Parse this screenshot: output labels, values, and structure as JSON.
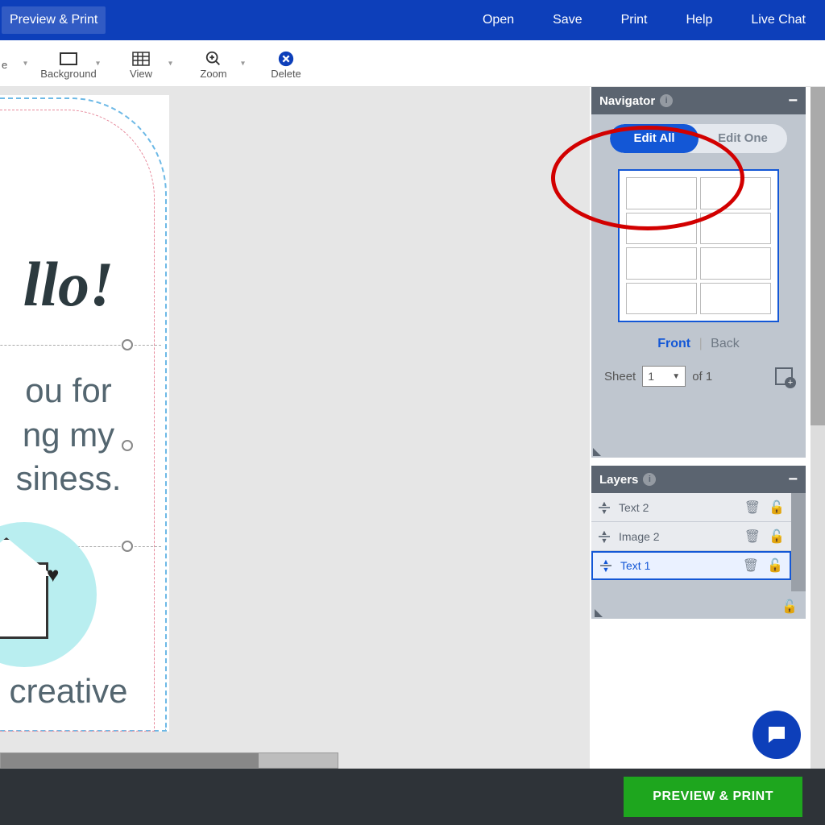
{
  "menu": {
    "preview": "Preview & Print",
    "open": "Open",
    "save": "Save",
    "print": "Print",
    "help": "Help",
    "chat": "Live Chat"
  },
  "toolbar": {
    "edge_partial": "e",
    "background": "Background",
    "view": "View",
    "zoom": "Zoom",
    "delete": "Delete"
  },
  "canvas": {
    "hello": "llo!",
    "line1": "ou for",
    "line2": "ng my",
    "line3": "siness.",
    "creative": "creative"
  },
  "navigator": {
    "title": "Navigator",
    "edit_all": "Edit All",
    "edit_one": "Edit One",
    "front": "Front",
    "back": "Back",
    "sheet_label": "Sheet",
    "sheet_current": "1",
    "sheet_of": "of 1"
  },
  "layers": {
    "title": "Layers",
    "items": [
      {
        "name": "Text 2"
      },
      {
        "name": "Image 2"
      },
      {
        "name": "Text 1"
      }
    ]
  },
  "footer": {
    "preview_print": "PREVIEW & PRINT"
  },
  "icons": {
    "info": "i",
    "minus": "−",
    "dropdown": "▼",
    "heart": "♥",
    "trash": "🗑",
    "unlock": "🔓"
  }
}
